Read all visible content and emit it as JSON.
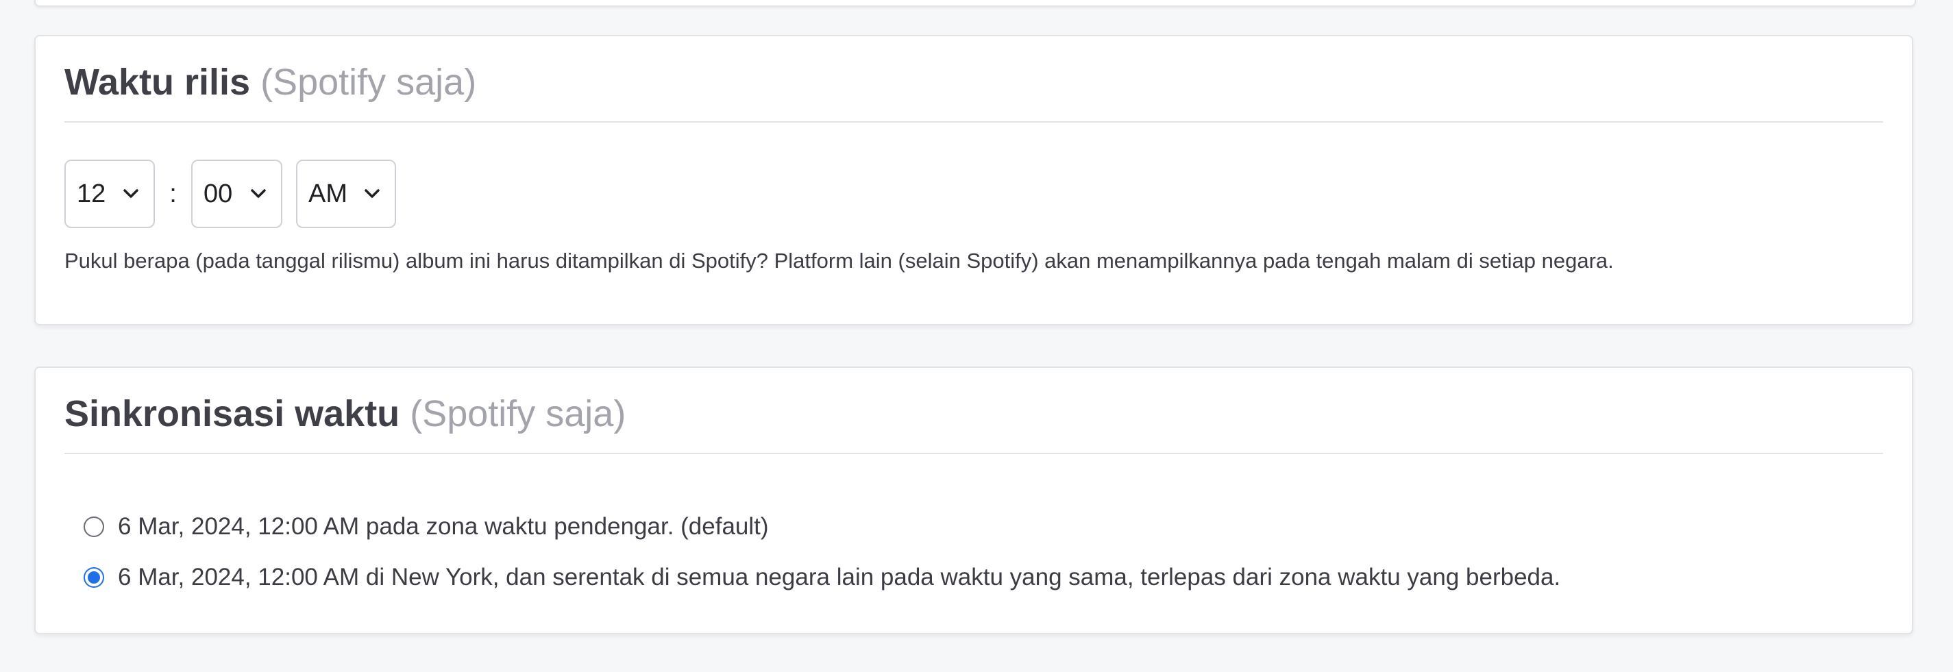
{
  "release_time": {
    "title": "Waktu rilis",
    "title_note": "(Spotify saja)",
    "hour": {
      "selected": "12"
    },
    "separator": ":",
    "minute": {
      "selected": "00"
    },
    "period": {
      "selected": "AM"
    },
    "help_text": "Pukul berapa (pada tanggal rilismu) album ini harus ditampilkan di Spotify? Platform lain (selain Spotify) akan menampilkannya pada tengah malam di setiap negara."
  },
  "time_sync": {
    "title": "Sinkronisasi waktu",
    "title_note": "(Spotify saja)",
    "options": [
      {
        "label": "6 Mar, 2024, 12:00 AM pada zona waktu pendengar. (default)",
        "selected": false
      },
      {
        "label": "6 Mar, 2024, 12:00 AM di New York, dan serentak di semua negara lain pada waktu yang sama, terlepas dari zona waktu yang berbeda.",
        "selected": true
      }
    ]
  },
  "colors": {
    "accent": "#1f6fe6",
    "title_text": "#3f3f47",
    "title_note": "#a3a3ab",
    "page_background": "#f6f7f9"
  },
  "icons": {
    "select_arrow": "chevron-down-icon"
  }
}
